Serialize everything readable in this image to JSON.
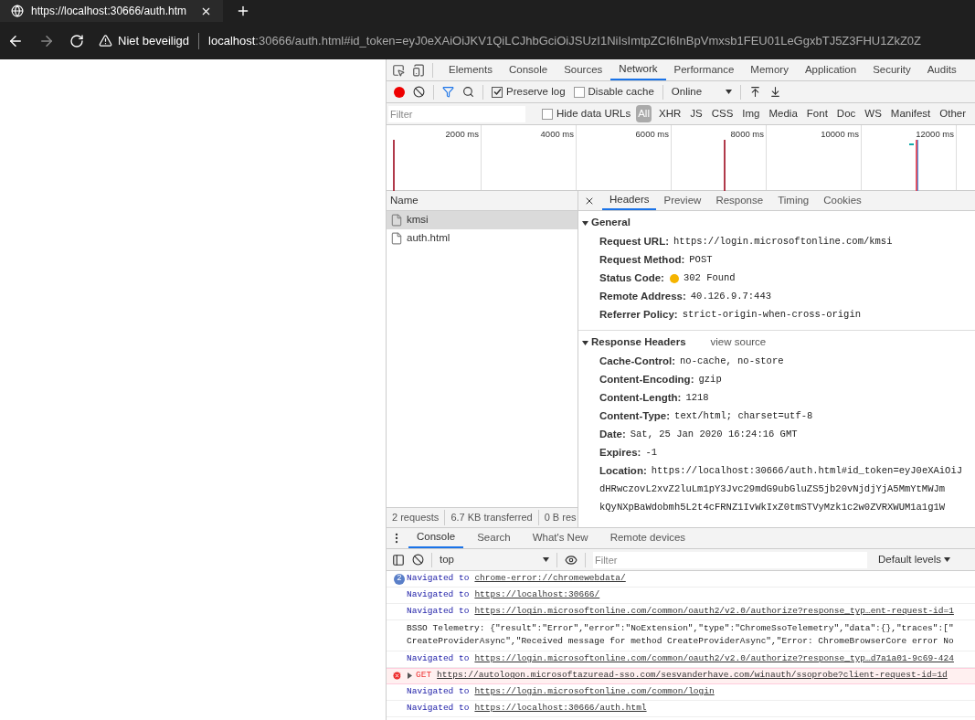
{
  "browser": {
    "tab_title": "https://localhost:30666/auth.htm",
    "security_label": "Niet beveiligd",
    "url_host": "localhost",
    "url_rest": ":30666/auth.html#id_token=eyJ0eXAiOiJKV1QiLCJhbGciOiJSUzI1NiIsImtpZCI6InBpVmxsb1FEU01LeGgxbTJ5Z3FHU1ZkZ0Z"
  },
  "devtools": {
    "tabs": [
      {
        "label": "Elements",
        "selected": false
      },
      {
        "label": "Console",
        "selected": false
      },
      {
        "label": "Sources",
        "selected": false
      },
      {
        "label": "Network",
        "selected": true
      },
      {
        "label": "Performance",
        "selected": false
      },
      {
        "label": "Memory",
        "selected": false
      },
      {
        "label": "Application",
        "selected": false
      },
      {
        "label": "Security",
        "selected": false
      },
      {
        "label": "Audits",
        "selected": false
      }
    ]
  },
  "network": {
    "preserve_log": {
      "label": "Preserve log",
      "checked": true
    },
    "disable_cache": {
      "label": "Disable cache",
      "checked": false
    },
    "throttling": "Online",
    "filter": {
      "placeholder": "Filter"
    },
    "hide_data_urls": {
      "label": "Hide data URLs",
      "checked": false
    },
    "types": [
      {
        "label": "All",
        "selected": true
      },
      {
        "label": "XHR",
        "selected": false
      },
      {
        "label": "JS",
        "selected": false
      },
      {
        "label": "CSS",
        "selected": false
      },
      {
        "label": "Img",
        "selected": false
      },
      {
        "label": "Media",
        "selected": false
      },
      {
        "label": "Font",
        "selected": false
      },
      {
        "label": "Doc",
        "selected": false
      },
      {
        "label": "WS",
        "selected": false
      },
      {
        "label": "Manifest",
        "selected": false
      },
      {
        "label": "Other",
        "selected": false
      }
    ],
    "timeline_ticks": [
      "2000 ms",
      "4000 ms",
      "6000 ms",
      "8000 ms",
      "10000 ms",
      "12000 ms"
    ],
    "name_column": "Name",
    "requests": [
      {
        "name": "kmsi",
        "selected": true
      },
      {
        "name": "auth.html",
        "selected": false
      }
    ],
    "summary": [
      "2 requests",
      "6.7 KB transferred",
      "0 B res"
    ],
    "detail_tabs": [
      {
        "label": "Headers",
        "selected": true
      },
      {
        "label": "Preview",
        "selected": false
      },
      {
        "label": "Response",
        "selected": false
      },
      {
        "label": "Timing",
        "selected": false
      },
      {
        "label": "Cookies",
        "selected": false
      }
    ],
    "general": {
      "title": "General",
      "expanded": true,
      "fields": [
        {
          "label": "Request URL:",
          "value": "https://login.microsoftonline.com/kmsi",
          "kind": "plain"
        },
        {
          "label": "Request Method:",
          "value": "POST",
          "kind": "plain"
        },
        {
          "label": "Status Code:",
          "value": "302 Found",
          "kind": "status"
        },
        {
          "label": "Remote Address:",
          "value": "40.126.9.7:443",
          "kind": "plain"
        },
        {
          "label": "Referrer Policy:",
          "value": "strict-origin-when-cross-origin",
          "kind": "plain"
        }
      ]
    },
    "response_headers": {
      "title": "Response Headers",
      "expanded": true,
      "view_source": "view source",
      "fields": [
        {
          "label": "Cache-Control:",
          "value": "no-cache, no-store"
        },
        {
          "label": "Content-Encoding:",
          "value": "gzip"
        },
        {
          "label": "Content-Length:",
          "value": "1218"
        },
        {
          "label": "Content-Type:",
          "value": "text/html; charset=utf-8"
        },
        {
          "label": "Date:",
          "value": "Sat, 25 Jan 2020 16:24:16 GMT"
        },
        {
          "label": "Expires:",
          "value": "-1"
        },
        {
          "label": "Location:",
          "value": "https://localhost:30666/auth.html#id_token=eyJ0eXAiOiJ"
        }
      ],
      "continuation": [
        "dHRwczovL2xvZ2luLm1pY3Jvc29mdG9ubGluZS5jb20vNjdjYjA5MmYtMWJm",
        "kQyNXpBaWdobmh5L2t4cFRNZ1IvWkIxZ0tmSTVyMzk1c2w0ZVRXWUM1a1g1W"
      ]
    }
  },
  "drawer": {
    "tabs": [
      {
        "label": "Console",
        "selected": true
      },
      {
        "label": "Search",
        "selected": false
      },
      {
        "label": "What's New",
        "selected": false
      },
      {
        "label": "Remote devices",
        "selected": false
      }
    ],
    "context": "top",
    "filter": {
      "placeholder": "Filter"
    },
    "levels": "Default levels",
    "messages": [
      {
        "kind": "nav",
        "count": "2",
        "text": "Navigated to",
        "link": "chrome-error://chromewebdata/"
      },
      {
        "kind": "nav",
        "text": "Navigated to",
        "link": "https://localhost:30666/"
      },
      {
        "kind": "nav",
        "text": "Navigated to",
        "link": "https://login.microsoftonline.com/common/oauth2/v2.0/authorize?response_typ…ent-request-id=1"
      },
      {
        "kind": "log",
        "lines": [
          "BSSO Telemetry: {\"result\":\"Error\",\"error\":\"NoExtension\",\"type\":\"ChromeSsoTelemetry\",\"data\":{},\"traces\":[\"",
          "CreateProviderAsync\",\"Received message for method CreateProviderAsync\",\"Error: ChromeBrowserCore error No"
        ]
      },
      {
        "kind": "nav",
        "text": "Navigated to",
        "link": "https://login.microsoftonline.com/common/oauth2/v2.0/authorize?response_typ…d7a1a01-9c69-424"
      },
      {
        "kind": "error",
        "text": "GET",
        "link": "https://autologon.microsoftazuread-sso.com/sesvanderhave.com/winauth/ssoprobe?client-request-id=1d"
      },
      {
        "kind": "nav",
        "text": "Navigated to",
        "link": "https://login.microsoftonline.com/common/login"
      },
      {
        "kind": "nav",
        "text": "Navigated to",
        "link": "https://localhost:30666/auth.html"
      }
    ]
  }
}
